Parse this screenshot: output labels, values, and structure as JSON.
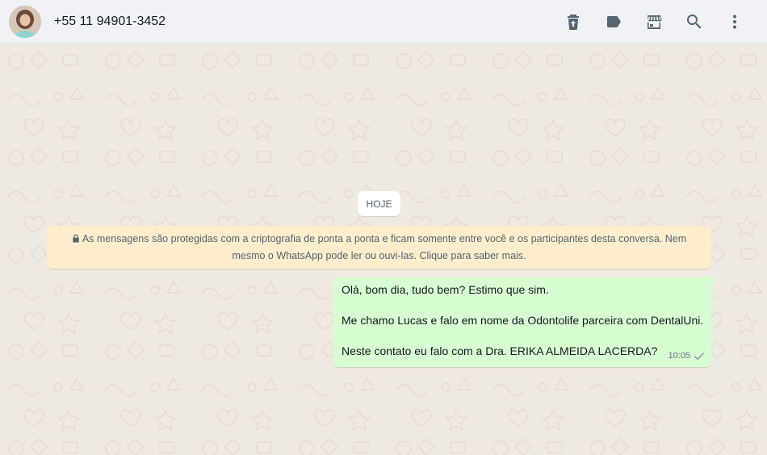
{
  "header": {
    "contact_name": "+55 11 94901-3452",
    "actions": [
      {
        "name": "archive-icon"
      },
      {
        "name": "label-icon"
      },
      {
        "name": "catalog-store-icon"
      },
      {
        "name": "search-icon"
      },
      {
        "name": "menu-dots-icon"
      }
    ]
  },
  "chat": {
    "date_chip": "HOJE",
    "encryption_notice": "As mensagens são protegidas com a criptografia de ponta a ponta e ficam somente entre você e os participantes desta conversa. Nem mesmo o WhatsApp pode ler ou ouvi-las. Clique para saber mais.",
    "messages": [
      {
        "direction": "outgoing",
        "lines": [
          "Olá, bom dia, tudo bem? Estimo que sim.",
          "Me chamo Lucas e falo em nome da Odontolife parceira com DentalUni.",
          "Neste contato eu falo com a Dra. ERIKA ALMEIDA LACERDA?"
        ],
        "time": "10:05",
        "status_icon": "single-check-icon"
      }
    ]
  },
  "colors": {
    "chat_background": "#efeae2",
    "outgoing_bubble": "#d9fdd3",
    "notice_background": "#ffeecd",
    "header_background": "#f0f2f5",
    "icon_gray": "#54656f"
  }
}
